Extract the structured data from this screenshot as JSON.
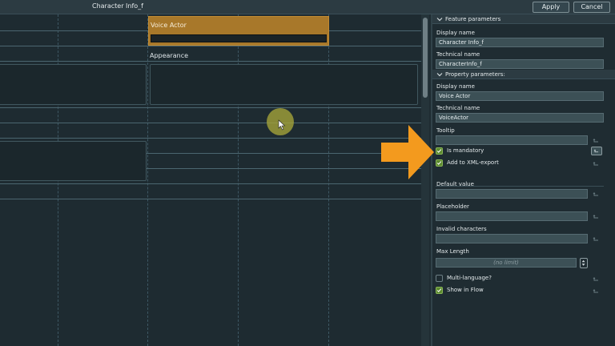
{
  "topbar": {
    "title": "Character Info_f",
    "apply_label": "Apply",
    "cancel_label": "Cancel"
  },
  "canvas": {
    "selected_cell_label": "Voice Actor",
    "appearance_label": "Appearance"
  },
  "panel": {
    "feature_header": "Feature parameters",
    "feature": {
      "display_name_label": "Display name",
      "display_name_value": "Character Info_f",
      "technical_name_label": "Technical name",
      "technical_name_value": "CharacterInfo_f"
    },
    "property_header": "Property parameters:",
    "property": {
      "display_name_label": "Display name",
      "display_name_value": "Voice Actor",
      "technical_name_label": "Technical name",
      "technical_name_value": "VoiceActor",
      "tooltip_label": "Tooltip",
      "tooltip_value": "",
      "is_mandatory_label": "Is mandatory",
      "is_mandatory_checked": true,
      "xml_export_label": "Add to XML-export",
      "xml_export_checked": true,
      "default_value_label": "Default value",
      "default_value": "",
      "placeholder_label": "Placeholder",
      "placeholder_value": "",
      "invalid_chars_label": "Invalid characters",
      "invalid_chars_value": "",
      "max_length_label": "Max Length",
      "max_length_placeholder": "(no limit)",
      "multilang_label": "Multi-language?",
      "multilang_checked": false,
      "show_in_flow_label": "Show in Flow",
      "show_in_flow_checked": true
    }
  },
  "colors": {
    "selection": "#a8782a",
    "annotation_arrow": "#f39a1e",
    "checkbox_on": "#5c8a30"
  }
}
